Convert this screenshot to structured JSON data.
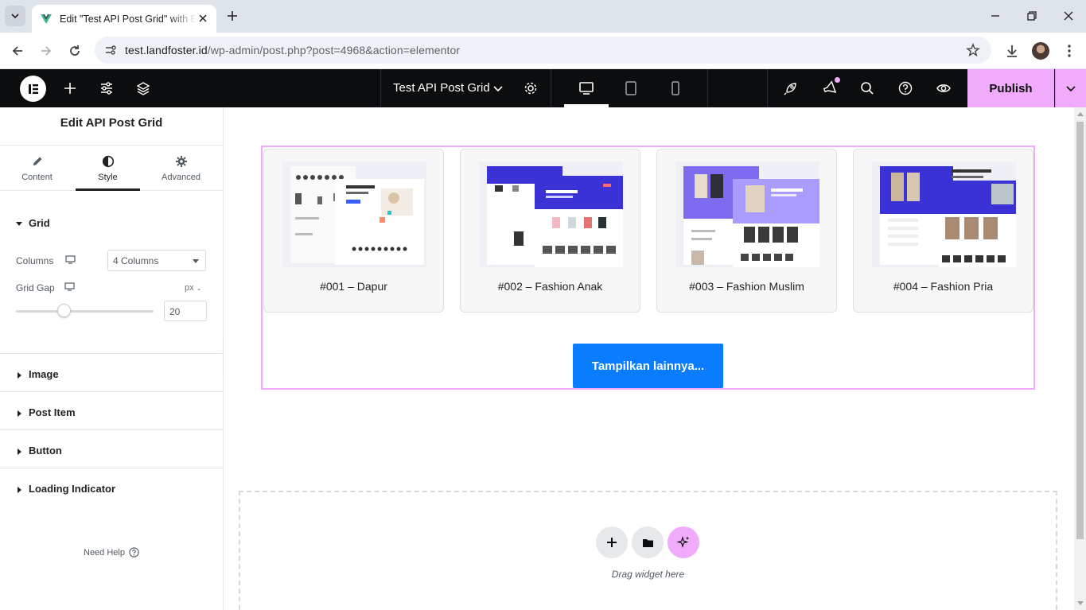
{
  "browser": {
    "tab_title": "Edit \"Test API Post Grid\" with Elementor",
    "url_host": "test.landfoster.id",
    "url_path": "/wp-admin/post.php?post=4968&action=elementor"
  },
  "topbar": {
    "document_title": "Test API Post Grid",
    "publish_label": "Publish",
    "accent_color": "#f0abfc"
  },
  "panel": {
    "title": "Edit API Post Grid",
    "tabs": [
      {
        "label": "Content",
        "icon": "pencil-icon"
      },
      {
        "label": "Style",
        "icon": "half-circle-icon"
      },
      {
        "label": "Advanced",
        "icon": "gear-icon"
      }
    ],
    "active_tab": "Style",
    "grid_section": "Grid",
    "columns_label": "Columns",
    "columns_value": "4 Columns",
    "grid_gap_label": "Grid Gap",
    "grid_gap_unit": "px",
    "grid_gap_value": "20",
    "grid_gap_slider_fraction": 0.2,
    "sections": [
      "Image",
      "Post Item",
      "Button",
      "Loading Indicator"
    ],
    "need_help": "Need Help"
  },
  "canvas": {
    "posts": [
      {
        "title": "#001 – Dapur"
      },
      {
        "title": "#002 – Fashion Anak"
      },
      {
        "title": "#003 – Fashion Muslim"
      },
      {
        "title": "#004 – Fashion Pria"
      }
    ],
    "load_more_label": "Tampilkan lainnya...",
    "load_more_color": "#0a7cff",
    "drop_text": "Drag widget here"
  }
}
